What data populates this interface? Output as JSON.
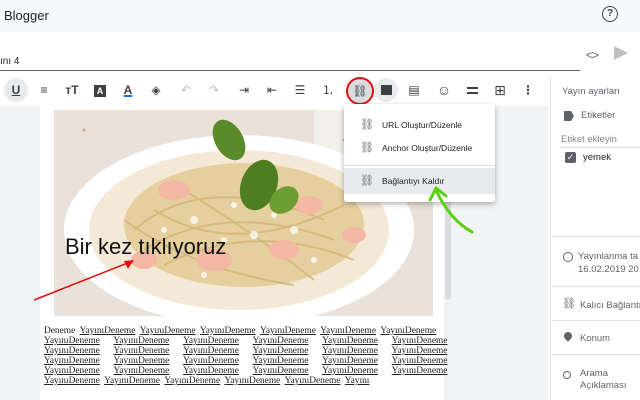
{
  "app": {
    "title": "Blogger",
    "help_icon": "help-circle-icon"
  },
  "post": {
    "title": "ını 4"
  },
  "header_actions": {
    "code_toggle": "<>",
    "publish_icon": "send-icon"
  },
  "toolbar": {
    "items": [
      {
        "name": "underline",
        "glyph": "U"
      },
      {
        "name": "strikethrough-lines",
        "glyph": "≡"
      },
      {
        "name": "font-size",
        "glyph": "тT"
      },
      {
        "name": "text-style",
        "glyph": "A"
      },
      {
        "name": "text-color",
        "glyph": "A"
      },
      {
        "name": "highlight-color",
        "glyph": "◈"
      },
      {
        "name": "undo",
        "glyph": "↶"
      },
      {
        "name": "redo",
        "glyph": "↷"
      },
      {
        "name": "indent",
        "glyph": "⇥"
      },
      {
        "name": "outdent",
        "glyph": "⇤"
      },
      {
        "name": "bulleted-list",
        "glyph": "☰"
      },
      {
        "name": "numbered-list",
        "glyph": "⒈"
      },
      {
        "name": "link",
        "glyph": "⛓"
      },
      {
        "name": "insert-image",
        "glyph": ""
      },
      {
        "name": "insert-video",
        "glyph": "▤"
      },
      {
        "name": "emoji",
        "glyph": "☺"
      },
      {
        "name": "align",
        "glyph": "⎯"
      },
      {
        "name": "table",
        "glyph": "⊞"
      },
      {
        "name": "more",
        "glyph": "⋮"
      }
    ],
    "text_color_accent": "#1a73e8",
    "highlight_accent": "#e01010"
  },
  "link_menu": {
    "items": [
      {
        "label": "URL Oluştur/Düzenle",
        "icon": "link-icon"
      },
      {
        "label": "Anchor Oluştur/Düzenle",
        "icon": "link-icon"
      },
      {
        "label": "Bağlantıyı Kaldır",
        "icon": "link-off-icon"
      }
    ]
  },
  "editor": {
    "caption": "Bir kez tıklıyoruz",
    "body_lines": [
      [
        "Deneme",
        "YayınıDeneme",
        "YayınıDeneme",
        "YayınıDeneme",
        "YayınıDeneme",
        "YayınıDeneme",
        "YayınıDeneme"
      ],
      [
        "YayınıDeneme",
        "YayınıDeneme",
        "YayınıDeneme",
        "YayınıDeneme",
        "YayınıDeneme",
        "YayınıDeneme"
      ],
      [
        "YayınıDeneme",
        "YayınıDeneme",
        "YayınıDeneme",
        "YayınıDeneme",
        "YayınıDeneme",
        "YayınıDeneme"
      ],
      [
        "YayınıDeneme",
        "YayınıDeneme",
        "YayınıDeneme",
        "YayınıDeneme",
        "YayınıDeneme",
        "YayınıDeneme"
      ],
      [
        "YayınıDeneme",
        "YayınıDeneme",
        "YayınıDeneme",
        "YayınıDeneme",
        "YayınıDeneme",
        "YayınıDeneme"
      ],
      [
        "YayınıDeneme",
        "YayınıDeneme",
        "YayınıDeneme",
        "YayınıDeneme",
        "YayınıDeneme",
        "Yayını"
      ]
    ]
  },
  "sidebar": {
    "heading": "Yayın ayarları",
    "labels_title": "Etiketler",
    "label_placeholder": "Etiket ekleyin",
    "label_checked": "yemek",
    "published_title": "Yayınlanma ta",
    "published_date": "16.02.2019 20",
    "permalink_title": "Kalıcı Bağlantı",
    "location_title": "Konum",
    "search_title_1": "Arama",
    "search_title_2": "Açıklaması"
  },
  "colors": {
    "accent": "#1a73e8",
    "annotation_red": "#e01010",
    "annotation_green": "#58d10f"
  }
}
